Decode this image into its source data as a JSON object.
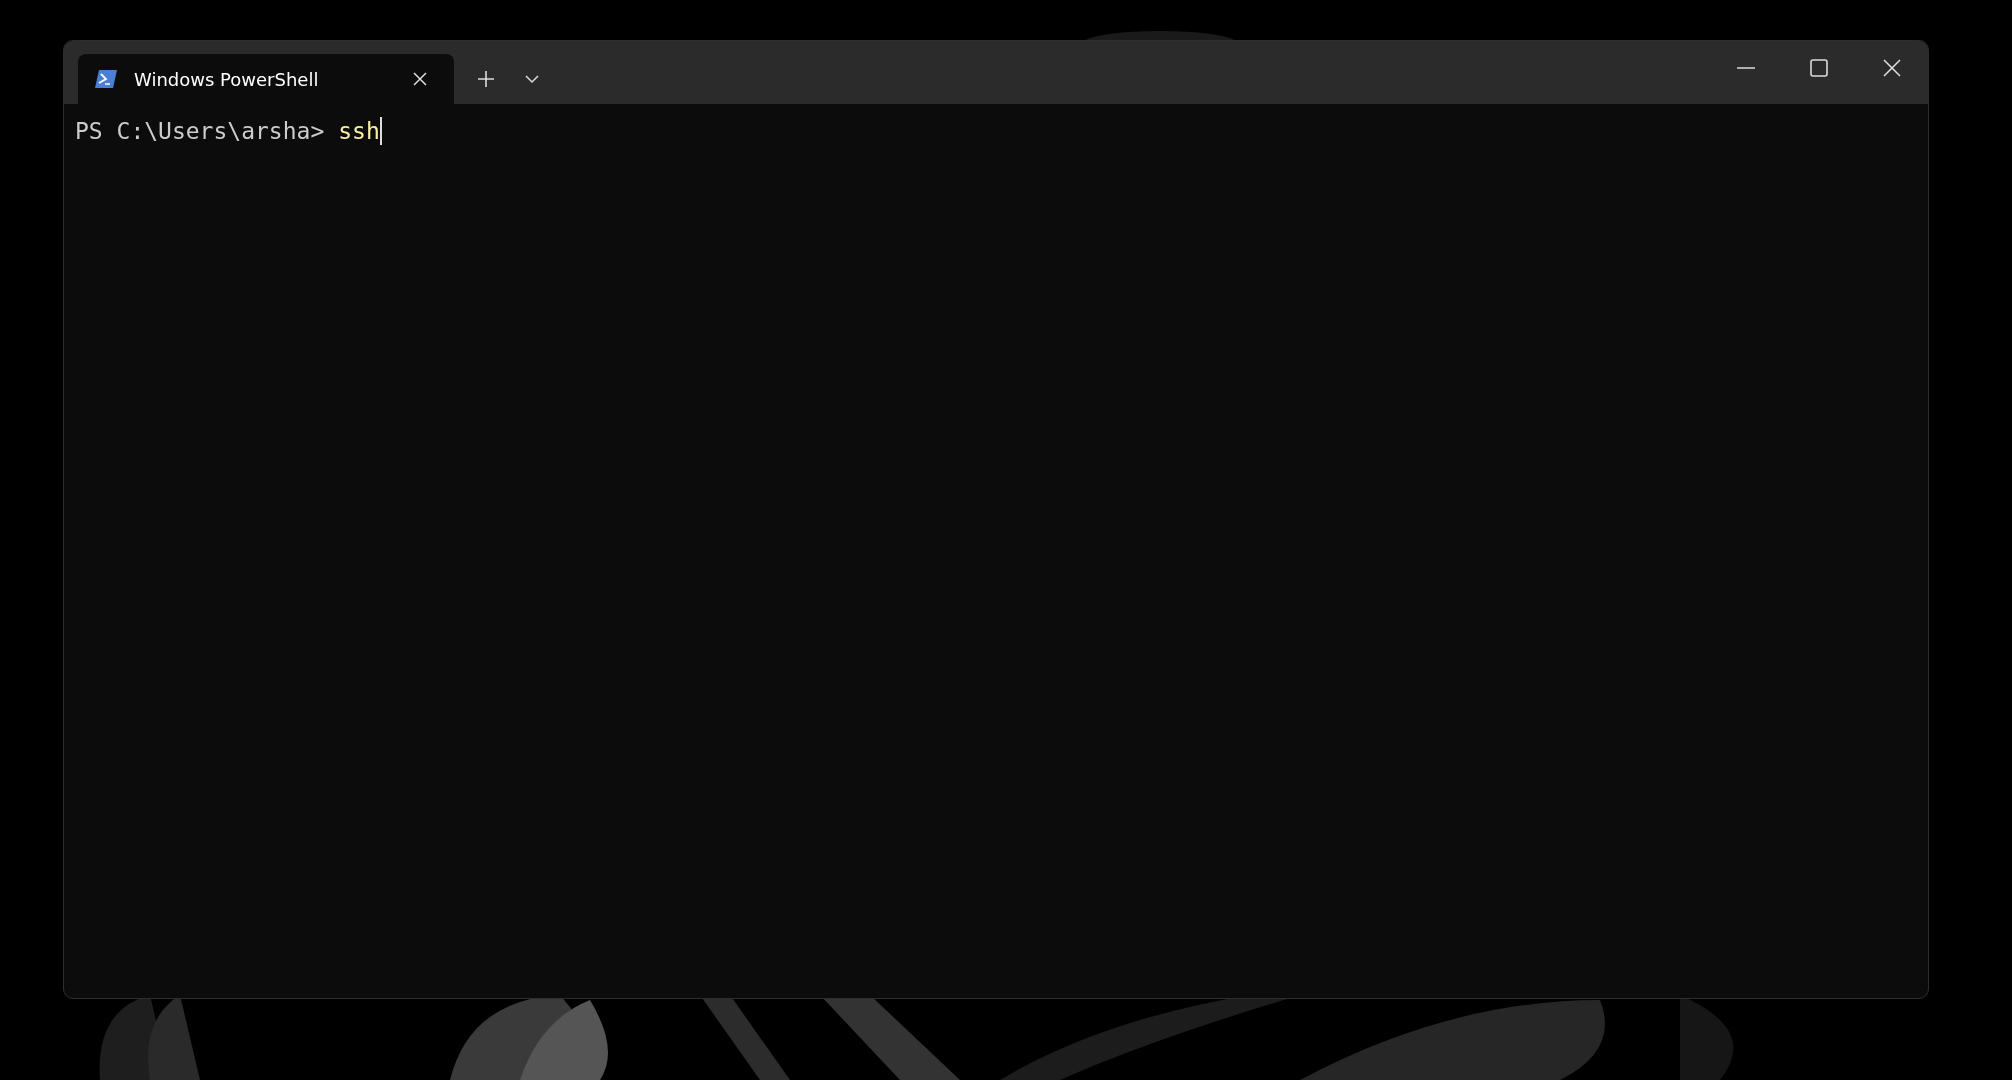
{
  "window": {
    "tabs": [
      {
        "title": "Windows PowerShell",
        "selected": true
      }
    ]
  },
  "terminal": {
    "lines": [
      {
        "prompt": "PS C:\\Users\\arsha>",
        "command": "ssh"
      }
    ]
  }
}
